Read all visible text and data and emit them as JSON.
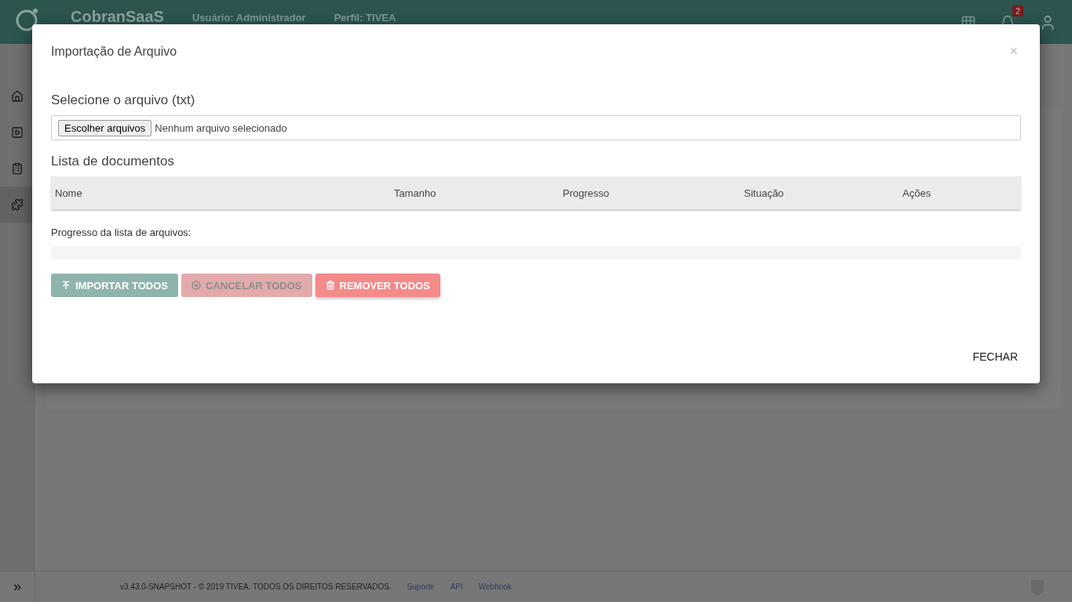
{
  "header": {
    "brand": "CobranSaaS",
    "user_label": "Usuário:",
    "user": "Administrador",
    "profile_label": "Perfil:",
    "profile": "TIVEA",
    "notification_count": "2"
  },
  "sidebar": {
    "items": [
      {
        "kind": "home",
        "selected": false
      },
      {
        "kind": "play",
        "selected": false
      },
      {
        "kind": "clipboard",
        "selected": false
      },
      {
        "kind": "puzzle",
        "selected": true
      }
    ],
    "toggle": "»"
  },
  "footer": {
    "copyright": "v3.43.0-SNAPSHOT - © 2019 TIVEA. TODOS OS DIREITOS RESERVADOS.",
    "links": [
      "Suporte",
      "API",
      "Webhook"
    ]
  },
  "modal": {
    "title": "Importação de Arquivo",
    "close": "×",
    "file_label": "Selecione o arquivo (txt)",
    "file_button": "Escolher arquivos",
    "file_status": "Nenhum arquivo selecionado",
    "list_title": "Lista de documentos",
    "columns": [
      "Nome",
      "Tamanho",
      "Progresso",
      "Situação",
      "Ações"
    ],
    "progress_label": "Progresso da lista de arquivos:",
    "progress": {
      "level": 0
    },
    "actions": [
      {
        "kind": "import",
        "label": "IMPORTAR TODOS",
        "disabled": true
      },
      {
        "kind": "cancel",
        "label": "CANCELAR TODOS",
        "disabled": true
      },
      {
        "kind": "remove",
        "label": "REMOVER TODOS",
        "disabled": false
      }
    ],
    "footer_button": "FECHAR"
  }
}
